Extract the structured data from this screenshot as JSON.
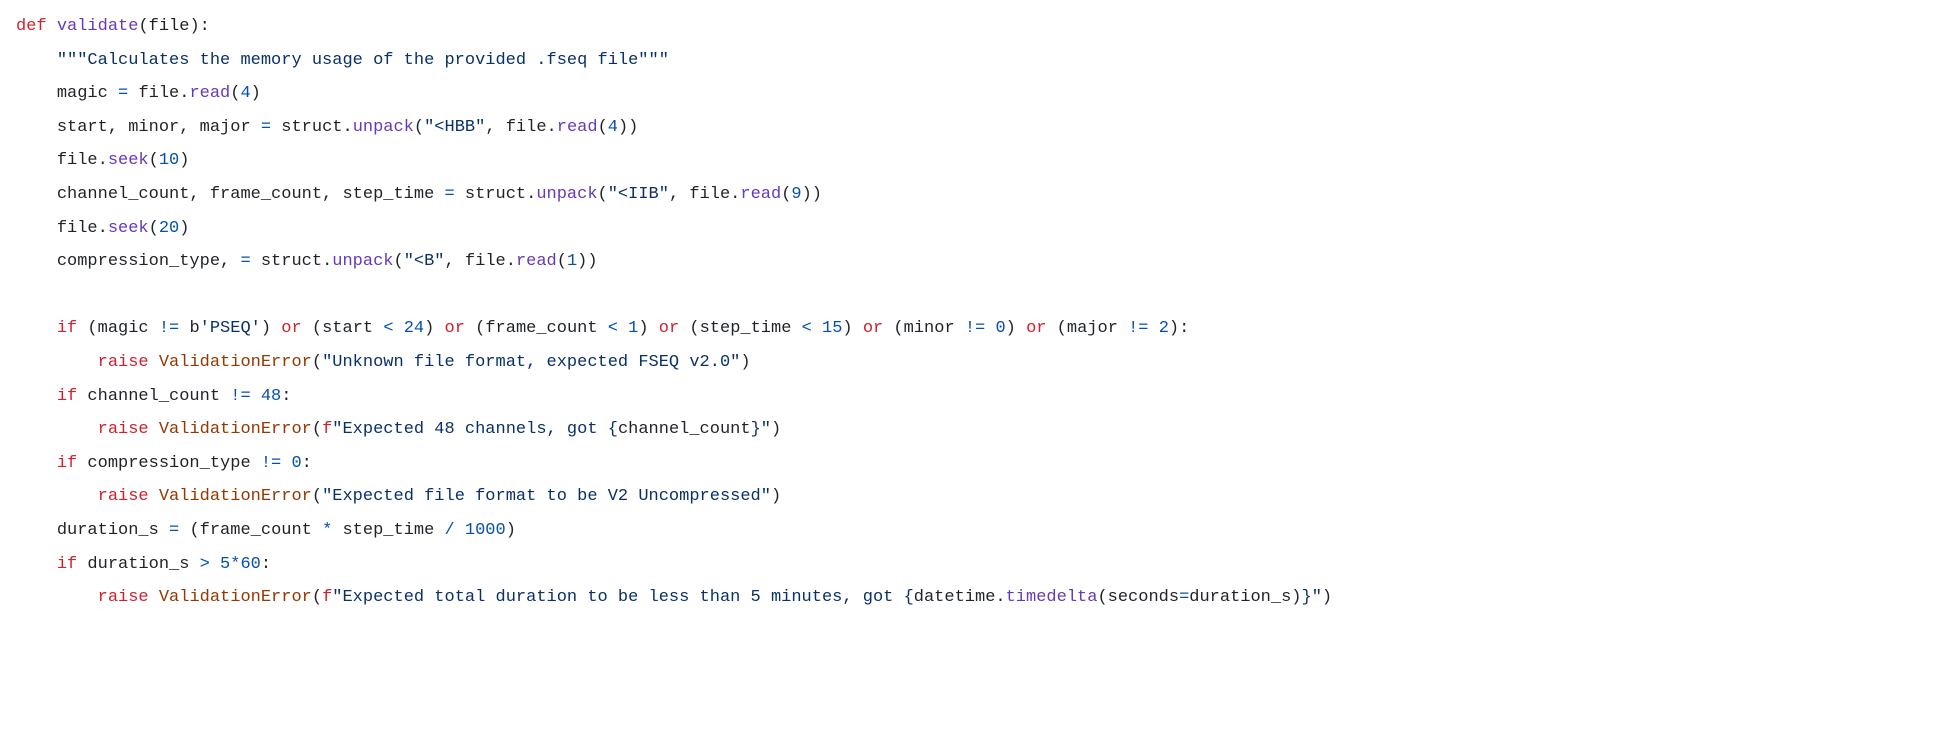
{
  "lang": "python",
  "code": {
    "l1_def": "def",
    "l1_fn": "validate",
    "l1_params": "(file):",
    "l2_doc": "\"\"\"Calculates the memory usage of the provided .fseq file\"\"\"",
    "l3_lhs": "magic",
    "l3_eq": "=",
    "l3_obj": "file.",
    "l3_call": "read",
    "l3_args_open": "(",
    "l3_arg0": "4",
    "l3_args_close": ")",
    "l4_lhs": "start, minor, major",
    "l4_eq": "=",
    "l4_mod": "struct.",
    "l4_unpack": "unpack",
    "l4_open": "(",
    "l4_fmt": "\"<HBB\"",
    "l4_comma": ", file.",
    "l4_read": "read",
    "l4_ropen": "(",
    "l4_rarg": "4",
    "l4_rclose": "))",
    "l5_obj": "file.",
    "l5_call": "seek",
    "l5_open": "(",
    "l5_arg": "10",
    "l5_close": ")",
    "l6_lhs": "channel_count, frame_count, step_time",
    "l6_eq": "=",
    "l6_mod": "struct.",
    "l6_unpack": "unpack",
    "l6_open": "(",
    "l6_fmt": "\"<IIB\"",
    "l6_comma": ", file.",
    "l6_read": "read",
    "l6_ropen": "(",
    "l6_rarg": "9",
    "l6_rclose": "))",
    "l7_obj": "file.",
    "l7_call": "seek",
    "l7_open": "(",
    "l7_arg": "20",
    "l7_close": ")",
    "l8_lhs": "compression_type,",
    "l8_eq": "=",
    "l8_mod": "struct.",
    "l8_unpack": "unpack",
    "l8_open": "(",
    "l8_fmt": "\"<B\"",
    "l8_comma": ", file.",
    "l8_read": "read",
    "l8_ropen": "(",
    "l8_rarg": "1",
    "l8_rclose": "))",
    "l10_if": "if",
    "l10_open1": " (magic ",
    "l10_ne": "!=",
    "l10_b": " b",
    "l10_pseq": "'PSEQ'",
    "l10_c1": ") ",
    "l10_or1": "or",
    "l10_p2a": " (start ",
    "l10_lt1": "<",
    "l10_sp1": " ",
    "l10_24": "24",
    "l10_c2": ") ",
    "l10_or2": "or",
    "l10_p3a": " (frame_count ",
    "l10_lt2": "<",
    "l10_sp2": " ",
    "l10_1": "1",
    "l10_c3": ") ",
    "l10_or3": "or",
    "l10_p4a": " (step_time ",
    "l10_lt3": "<",
    "l10_sp3": " ",
    "l10_15": "15",
    "l10_c4": ") ",
    "l10_or4": "or",
    "l10_p5a": " (minor ",
    "l10_ne2": "!=",
    "l10_sp4": " ",
    "l10_0": "0",
    "l10_c5": ") ",
    "l10_or5": "or",
    "l10_p6a": " (major ",
    "l10_ne3": "!=",
    "l10_sp5": " ",
    "l10_2": "2",
    "l10_c6": "):",
    "l11_raise": "raise",
    "l11_cls": "ValidationError",
    "l11_open": "(",
    "l11_str": "\"Unknown file format, expected FSEQ v2.0\"",
    "l11_close": ")",
    "l12_if": "if",
    "l12_expr_a": " channel_count ",
    "l12_ne": "!=",
    "l12_sp": " ",
    "l12_48": "48",
    "l12_colon": ":",
    "l13_raise": "raise",
    "l13_cls": "ValidationError",
    "l13_open": "(",
    "l13_f": "f",
    "l13_s1": "\"Expected 48 channels, got ",
    "l13_iopen": "{",
    "l13_ivar": "channel_count",
    "l13_iclose": "}",
    "l13_s2": "\"",
    "l13_close": ")",
    "l14_if": "if",
    "l14_expr_a": " compression_type ",
    "l14_ne": "!=",
    "l14_sp": " ",
    "l14_0": "0",
    "l14_colon": ":",
    "l15_raise": "raise",
    "l15_cls": "ValidationError",
    "l15_open": "(",
    "l15_str": "\"Expected file format to be V2 Uncompressed\"",
    "l15_close": ")",
    "l16_lhs": "duration_s",
    "l16_eq": "=",
    "l16_open": " (frame_count ",
    "l16_mul": "*",
    "l16_mid": " step_time ",
    "l16_div": "/",
    "l16_sp": " ",
    "l16_1000": "1000",
    "l16_close": ")",
    "l17_if": "if",
    "l17_a": " duration_s ",
    "l17_gt": ">",
    "l17_sp": " ",
    "l17_5": "5",
    "l17_mul": "*",
    "l17_60": "60",
    "l17_colon": ":",
    "l18_raise": "raise",
    "l18_cls": "ValidationError",
    "l18_open": "(",
    "l18_f": "f",
    "l18_s1": "\"Expected total duration to be less than 5 minutes, got ",
    "l18_iopen": "{",
    "l18_dt": "datetime.",
    "l18_td": "timedelta",
    "l18_kw_open": "(",
    "l18_kw": "seconds",
    "l18_kw_eq": "=",
    "l18_kw_val": "duration_s",
    "l18_kw_close": ")",
    "l18_iclose": "}",
    "l18_s2": "\"",
    "l18_close": ")"
  }
}
